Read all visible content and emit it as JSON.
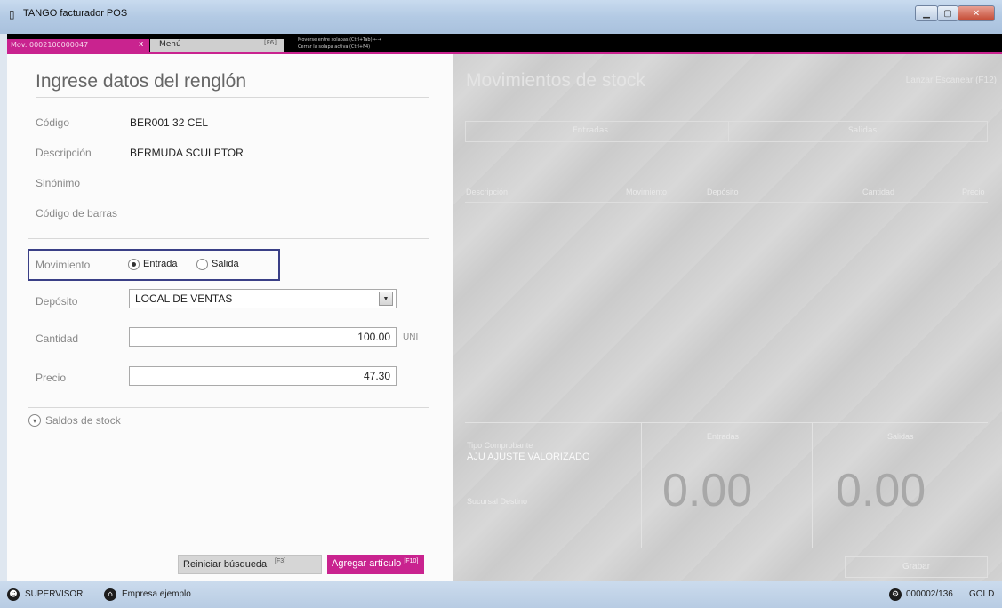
{
  "window": {
    "title": "TANGO facturador POS"
  },
  "tabs": {
    "doc_tab": "Mov. 0002100000047",
    "close_glyph": "x",
    "menu_tab": "Menú",
    "menu_key": "[F6]",
    "hint_line1": "Moverse entre solapas (Ctrl+Tab) ←→",
    "hint_line2": "Cerrar la solapa activa (Ctrl+F4)"
  },
  "form": {
    "title": "Ingrese datos del renglón",
    "codigo_label": "Código",
    "codigo_value": "BER001  32 CEL",
    "descripcion_label": "Descripción",
    "descripcion_value": "BERMUDA SCULPTOR",
    "sinonimo_label": "Sinónimo",
    "sinonimo_value": "",
    "codigo_barras_label": "Código de barras",
    "codigo_barras_value": "",
    "movimiento_label": "Movimiento",
    "entrada_label": "Entrada",
    "salida_label": "Salida",
    "movimiento_selected": "Entrada",
    "deposito_label": "Depósito",
    "deposito_value": "LOCAL DE VENTAS",
    "cantidad_label": "Cantidad",
    "cantidad_value": "100.00",
    "cantidad_unit": "UNI",
    "precio_label": "Precio",
    "precio_value": "47.30",
    "saldos_label": "Saldos de stock",
    "reiniciar_label": "Reiniciar búsqueda",
    "reiniciar_key": "[F3]",
    "agregar_label": "Agregar artículo",
    "agregar_key": "[F10]"
  },
  "movimientos": {
    "title": "Movimientos de stock",
    "corner_label": "Lanzar Escanear (F12)",
    "hdr_left": "Entradas",
    "hdr_right": "Salidas",
    "col_descripcion": "Descripción",
    "col_movimiento": "Movimiento",
    "col_deposito": "Depósito",
    "col_cantidad": "Cantidad",
    "col_precio": "Precio",
    "tipo_label": "Tipo Comprobante",
    "tipo_value": "AJU AJUSTE VALORIZADO",
    "sucursal_label": "Sucursal Destino",
    "entradas_label": "Entradas",
    "salidas_label": "Salidas",
    "entradas_value": "0.00",
    "salidas_value": "0.00",
    "grabar_label": "Grabar"
  },
  "status": {
    "user": "SUPERVISOR",
    "company": "Empresa ejemplo",
    "terminal": "000002/136",
    "edition": "GOLD"
  },
  "colors": {
    "accent": "#c9238f",
    "highlight_border": "#3a3f86"
  },
  "icons": {
    "app": "tango-app-icon",
    "user": "user-icon",
    "company": "company-icon",
    "terminal": "terminal-icon",
    "expand": "chevron-down-circle-icon",
    "dropdown": "dropdown-arrow-icon"
  }
}
